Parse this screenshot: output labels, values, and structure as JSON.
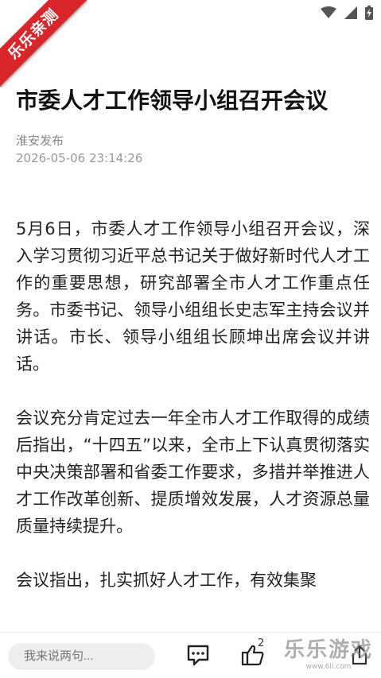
{
  "corner_banner": {
    "label": "乐乐亲测"
  },
  "article": {
    "title": "市委人才工作领导小组召开会议",
    "source": "淮安发布",
    "datetime": "2026-05-06 23:14:26",
    "paragraphs": [
      "5月6日，市委人才工作领导小组召开会议，深入学习贯彻习近平总书记关于做好新时代人才工作的重要思想，研究部署全市人才工作重点任务。市委书记、领导小组组长史志军主持会议并讲话。市长、领导小组组长顾坤出席会议并讲话。",
      "会议充分肯定过去一年全市人才工作取得的成绩后指出，“十四五”以来，全市上下认真贯彻落实中央决策部署和省委工作要求，多措并举推进人才工作改革创新、提质增效发展，人才资源总量质量持续提升。",
      "会议指出，扎实抓好人才工作，有效集聚"
    ]
  },
  "bottom_bar": {
    "comment_placeholder": "我来说两句...",
    "like_count": "2",
    "comment_icon": "comment-icon",
    "like_icon": "thumbs-up-icon"
  },
  "watermark": {
    "logo": "乐乐游戏",
    "url": "www.6ll.com"
  },
  "colors": {
    "ribbon": "#d9262b",
    "meta_text": "#888888",
    "input_bg": "#eeeeee"
  }
}
